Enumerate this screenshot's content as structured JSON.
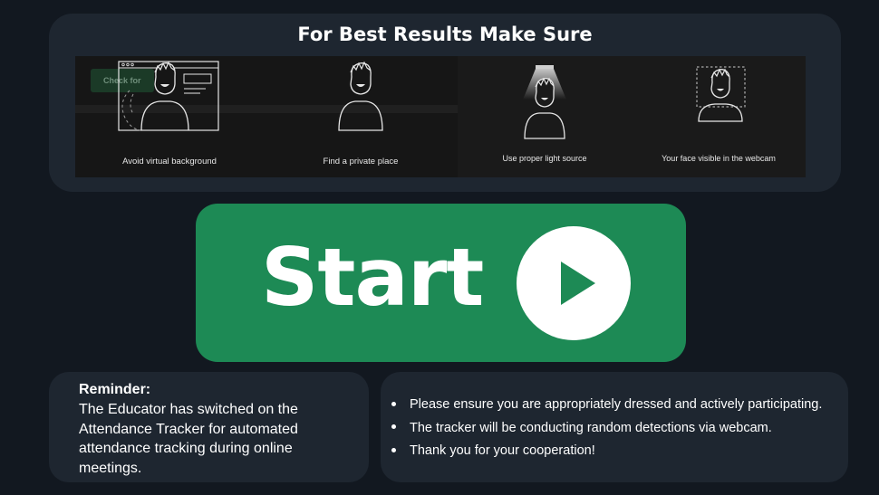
{
  "tips": {
    "title": "For Best Results Make Sure",
    "ghost_button_label": "Check for",
    "items": [
      {
        "label": "Avoid virtual background",
        "icon": "virtual-background-icon"
      },
      {
        "label": "Find a private place",
        "icon": "private-place-icon"
      },
      {
        "label": "Use proper light source",
        "icon": "light-source-icon"
      },
      {
        "label": "Your face visible in the webcam",
        "icon": "face-frame-icon"
      }
    ]
  },
  "start": {
    "label": "Start",
    "icon": "play-icon"
  },
  "reminder": {
    "title": "Reminder:",
    "text": "The Educator has switched on the Attendance Tracker for automated attendance tracking during online meetings."
  },
  "notes": {
    "items": [
      "Please ensure you are appropriately dressed and actively participating.",
      "The tracker will be conducting random detections via webcam.",
      "Thank you for your cooperation!"
    ]
  },
  "colors": {
    "background": "#121820",
    "card": "#1e2630",
    "start_green": "#1d8a55",
    "strip": "#161616"
  }
}
